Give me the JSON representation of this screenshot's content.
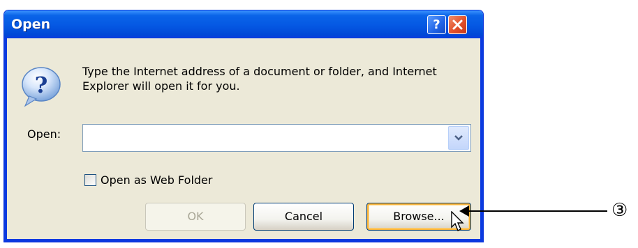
{
  "dialog": {
    "title": "Open",
    "help_label": "?",
    "close_label": "✕",
    "message": "Type the Internet address of a document or folder, and Internet Explorer will open it for you.",
    "open_label": "Open:",
    "url_value": "",
    "webfolder_label": "Open as Web Folder",
    "webfolder_checked": false,
    "ok_label": "OK",
    "ok_enabled": false,
    "cancel_label": "Cancel",
    "browse_label": "Browse..."
  },
  "annotation": {
    "number": "③"
  },
  "icons": {
    "message_icon": "question-icon",
    "dropdown_icon": "chevron-down-icon",
    "cursor_icon": "mouse-cursor-icon"
  },
  "colors": {
    "titlebar": "#0558e3",
    "dialog_bg": "#ece9d8",
    "close_red": "#e2502b",
    "focus_orange": "#f8b33a"
  }
}
